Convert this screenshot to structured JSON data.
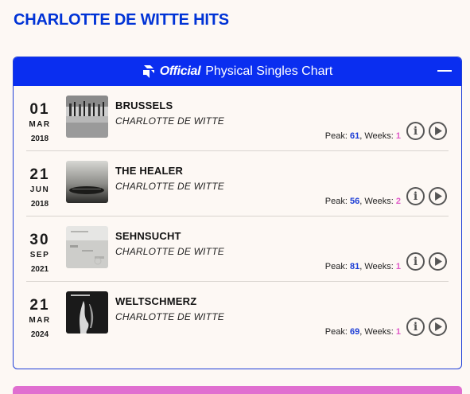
{
  "page": {
    "title": "CHARLOTTE DE WITTE HITS"
  },
  "chart": {
    "brand": "Official",
    "name": "Physical Singles Chart"
  },
  "colors": {
    "accent": "#0a2ef0",
    "title": "#0033d6",
    "weeks": "#e05bc8",
    "peak": "#1d3ed6"
  },
  "entries": [
    {
      "day": "01",
      "month": "MAR",
      "year": "2018",
      "title": "BRUSSELS",
      "artist": "CHARLOTTE DE WITTE",
      "peak_label": "Peak:",
      "peak": "61",
      "weeks_label": "Weeks:",
      "weeks": "1",
      "cover": "cover-brussels"
    },
    {
      "day": "21",
      "month": "JUN",
      "year": "2018",
      "title": "THE HEALER",
      "artist": "CHARLOTTE DE WITTE",
      "peak_label": "Peak:",
      "peak": "56",
      "weeks_label": "Weeks:",
      "weeks": "2",
      "cover": "cover-the-healer"
    },
    {
      "day": "30",
      "month": "SEP",
      "year": "2021",
      "title": "SEHNSUCHT",
      "artist": "CHARLOTTE DE WITTE",
      "peak_label": "Peak:",
      "peak": "81",
      "weeks_label": "Weeks:",
      "weeks": "1",
      "cover": "cover-sehnsucht"
    },
    {
      "day": "21",
      "month": "MAR",
      "year": "2024",
      "title": "WELTSCHMERZ",
      "artist": "CHARLOTTE DE WITTE",
      "peak_label": "Peak:",
      "peak": "69",
      "weeks_label": "Weeks:",
      "weeks": "1",
      "cover": "cover-weltschmerz"
    }
  ],
  "icons": {
    "info": "info-icon",
    "play": "play-icon",
    "collapse": "minus-icon"
  }
}
